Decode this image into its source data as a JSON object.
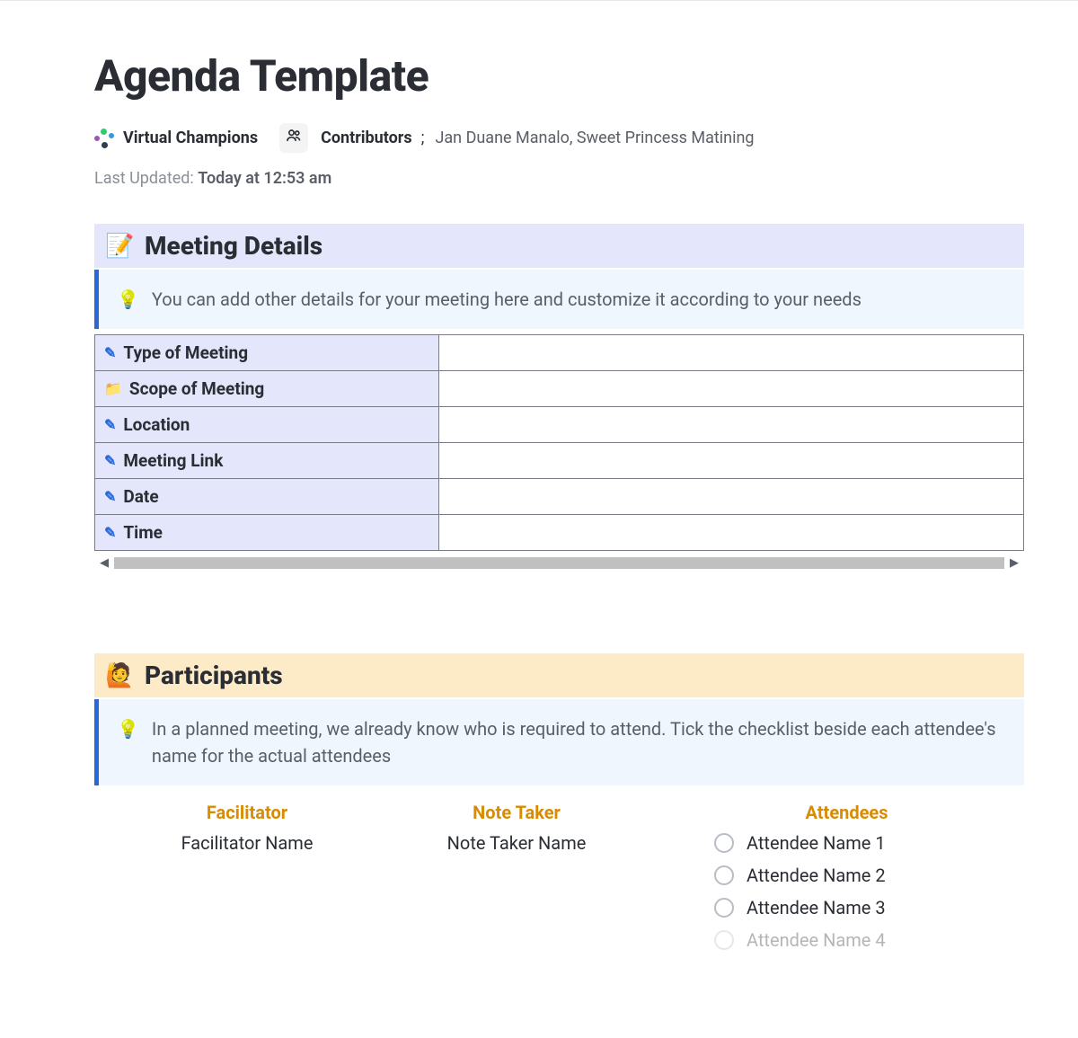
{
  "title": "Agenda Template",
  "workspace": {
    "name": "Virtual Champions"
  },
  "contributors": {
    "label": "Contributors",
    "names": "Jan Duane Manalo, Sweet Princess Matining"
  },
  "last_updated": {
    "label": "Last Updated:",
    "value": "Today at 12:53 am"
  },
  "sections": {
    "meeting_details": {
      "icon": "📝",
      "title": "Meeting Details",
      "callout": "You can add other details for your meeting here and customize it according to your needs",
      "rows": [
        {
          "icon": "pencil",
          "label": "Type of Meeting",
          "value": ""
        },
        {
          "icon": "folder",
          "label": "Scope of Meeting",
          "value": ""
        },
        {
          "icon": "pencil",
          "label": "Location",
          "value": ""
        },
        {
          "icon": "pencil",
          "label": "Meeting Link",
          "value": ""
        },
        {
          "icon": "pencil",
          "label": "Date",
          "value": ""
        },
        {
          "icon": "pencil",
          "label": "Time",
          "value": ""
        }
      ]
    },
    "participants": {
      "icon": "🙋",
      "title": "Participants",
      "callout": "In a planned meeting, we already know who is required to attend. Tick the checklist beside each attendee's name for the actual attendees",
      "facilitator": {
        "title": "Facilitator",
        "value": "Facilitator Name"
      },
      "note_taker": {
        "title": "Note Taker",
        "value": "Note Taker Name"
      },
      "attendees": {
        "title": "Attendees",
        "items": [
          {
            "name": "Attendee Name 1",
            "checked": false
          },
          {
            "name": "Attendee Name 2",
            "checked": false
          },
          {
            "name": "Attendee Name 3",
            "checked": false
          },
          {
            "name": "Attendee Name 4",
            "checked": false
          }
        ]
      }
    }
  }
}
